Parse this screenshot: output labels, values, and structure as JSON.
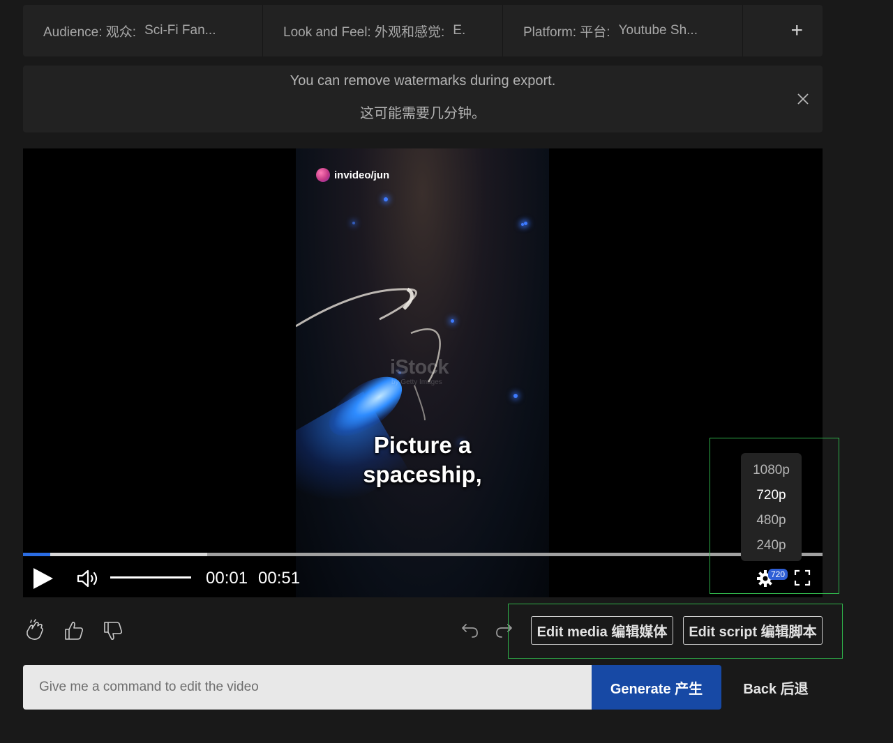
{
  "tags": [
    {
      "label": "Audience: 观众:",
      "value": "Sci-Fi Fan..."
    },
    {
      "label": "Look and Feel: 外观和感觉:",
      "value": "E."
    },
    {
      "label": "Platform: 平台:",
      "value": "Youtube Sh..."
    }
  ],
  "tags_add_label": "+",
  "notice": {
    "line1": "You can remove watermarks during export.",
    "line2": "这可能需要几分钟。"
  },
  "video": {
    "brand_text": "invideo/jun",
    "watermark": "iStock",
    "watermark_sub": "by Getty Images",
    "caption_line1": "Picture a",
    "caption_line2": "spaceship,",
    "progress_played_fraction": 0.034,
    "progress_buffered_fraction": 0.23,
    "time_current": "00:01",
    "time_total": "00:51",
    "quality_badge": "720",
    "quality_options": [
      {
        "label": "1080p",
        "selected": false
      },
      {
        "label": "720p",
        "selected": true
      },
      {
        "label": "480p",
        "selected": false
      },
      {
        "label": "240p",
        "selected": false
      }
    ]
  },
  "actions": {
    "edit_media_label": "Edit media 编辑媒体",
    "edit_script_label": "Edit script 编辑脚本"
  },
  "command": {
    "placeholder": "Give me a command to edit the video",
    "generate_label": "Generate 产生",
    "back_label": "Back 后退"
  },
  "colors": {
    "accent": "#1749a5",
    "progress": "#2b6de3",
    "highlight": "#2fb14a"
  },
  "icons": [
    "clap-icon",
    "thumbs-up-icon",
    "thumbs-down-icon",
    "undo-icon",
    "redo-icon",
    "play-icon",
    "volume-icon",
    "gear-icon",
    "fullscreen-icon",
    "close-icon"
  ]
}
